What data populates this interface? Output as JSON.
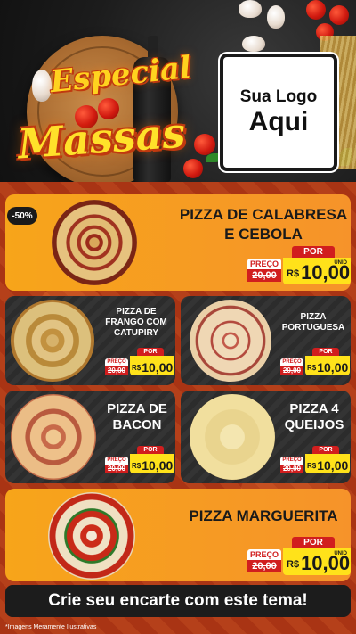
{
  "header": {
    "title_line1": "Especial",
    "title_line2": "Massas",
    "logo_line1": "Sua Logo",
    "logo_line2": "Aqui"
  },
  "discount_badge": "-50%",
  "price_labels": {
    "preco": "PREÇO",
    "por": "POR",
    "currency": "R$",
    "unit": "UNID"
  },
  "items": [
    {
      "name": "PIZZA DE CALABRESA E CEBOLA",
      "old_price": "20,00",
      "new_price": "10,00"
    },
    {
      "name": "PIZZA DE FRANGO COM CATUPIRY",
      "old_price": "20,00",
      "new_price": "10,00"
    },
    {
      "name": "PIZZA PORTUGUESA",
      "old_price": "20,00",
      "new_price": "10,00"
    },
    {
      "name": "PIZZA DE BACON",
      "old_price": "20,00",
      "new_price": "10,00"
    },
    {
      "name": "PIZZA 4 QUEIJOS",
      "old_price": "20,00",
      "new_price": "10,00"
    },
    {
      "name": "PIZZA MARGUERITA",
      "old_price": "20,00",
      "new_price": "10,00"
    }
  ],
  "cta": "Crie seu encarte com este tema!",
  "footnote": "*Imagens Meramente Ilustrativas",
  "colors": {
    "orange": "#f7a51a",
    "red": "#d11e1e",
    "yellow": "#ffe21a",
    "dark": "#2c2c2c"
  }
}
